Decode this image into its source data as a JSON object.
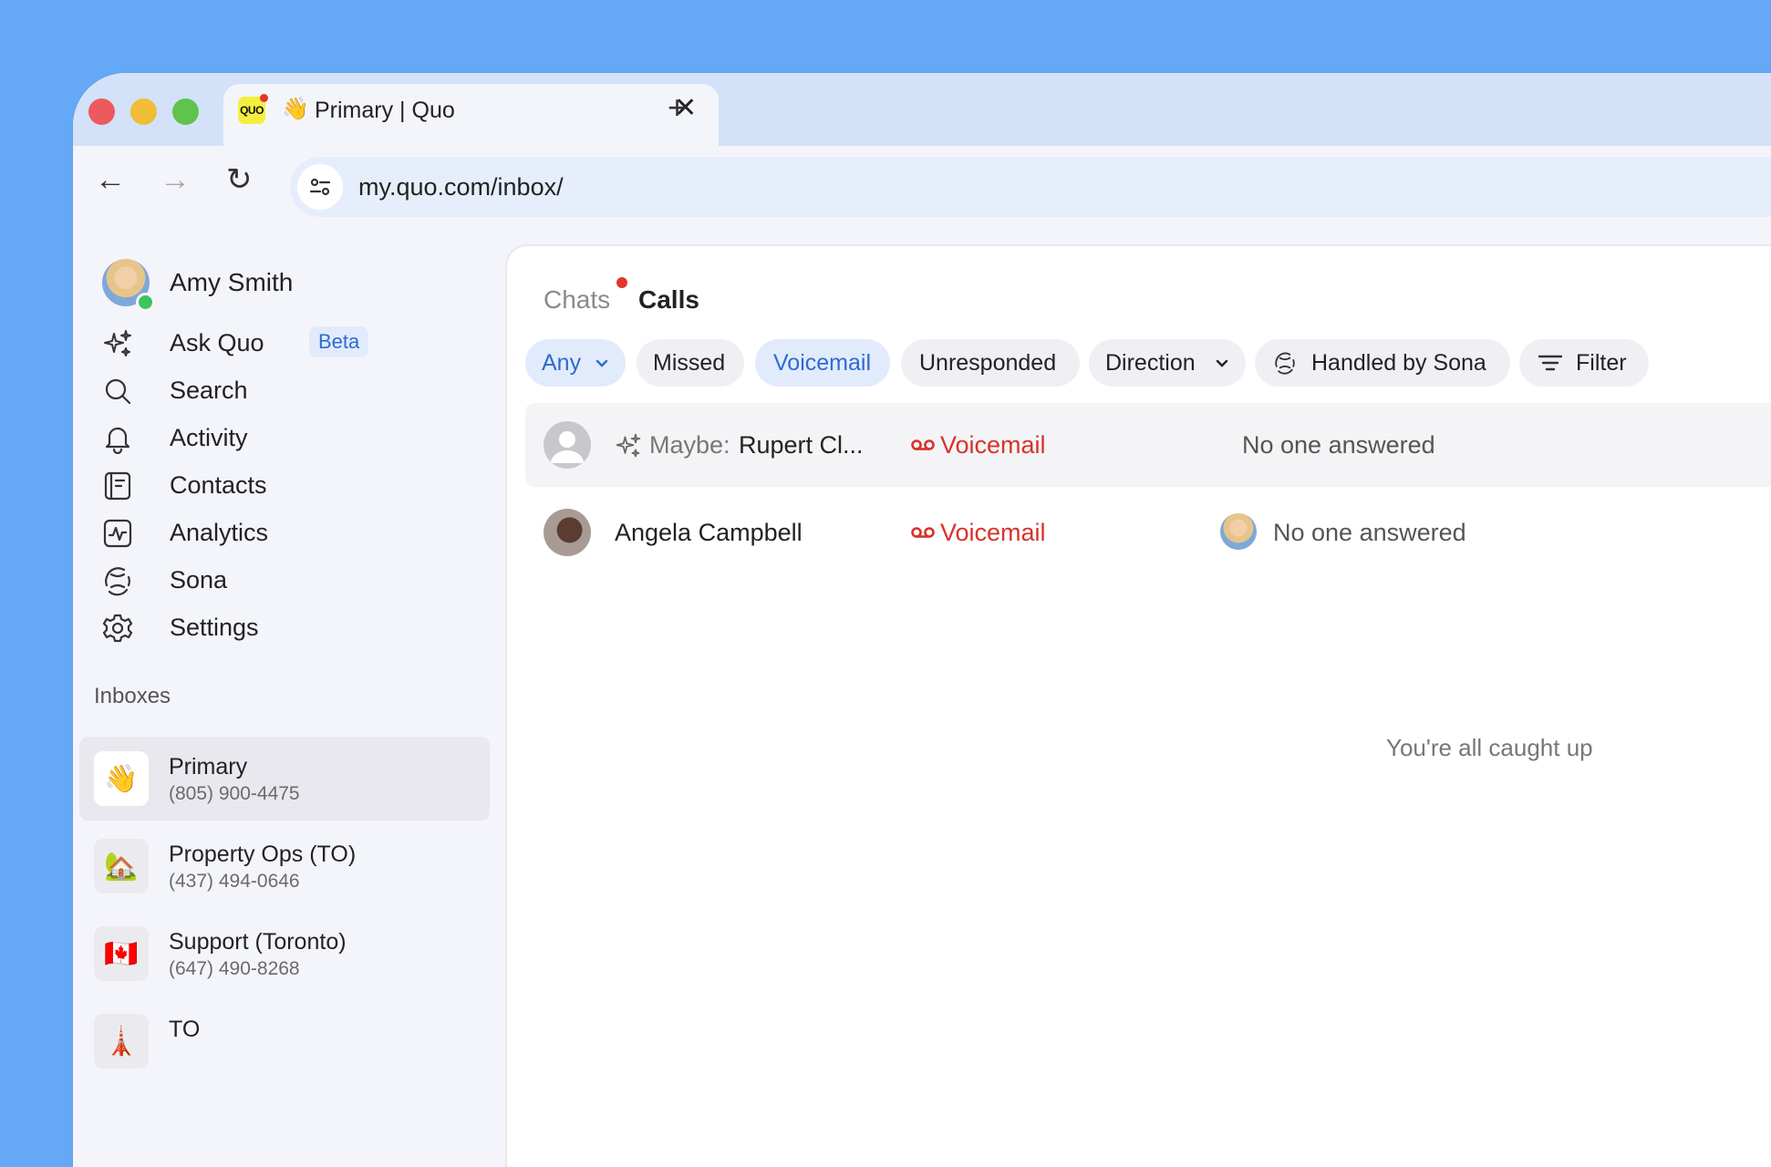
{
  "browser": {
    "favicon_text": "QUO",
    "tab_emoji": "👋",
    "tab_title": "Primary | Quo",
    "tab_close": "✕",
    "new_tab": "+",
    "back": "←",
    "forward": "→",
    "reload": "↻",
    "url": "my.quo.com/inbox/"
  },
  "user": {
    "name": "Amy Smith"
  },
  "sidebar": {
    "nav": [
      {
        "label": "Ask Quo",
        "icon": "sparkles-icon",
        "badge": "Beta"
      },
      {
        "label": "Search",
        "icon": "search-icon"
      },
      {
        "label": "Activity",
        "icon": "bell-icon"
      },
      {
        "label": "Contacts",
        "icon": "contacts-icon"
      },
      {
        "label": "Analytics",
        "icon": "analytics-icon"
      },
      {
        "label": "Sona",
        "icon": "sona-icon"
      },
      {
        "label": "Settings",
        "icon": "gear-icon"
      }
    ],
    "inboxes_header": "Inboxes",
    "inboxes": [
      {
        "emoji": "👋",
        "name": "Primary",
        "number": "(805) 900-4475",
        "active": true
      },
      {
        "emoji": "🏡",
        "name": "Property Ops (TO)",
        "number": "(437) 494-0646"
      },
      {
        "emoji": "🇨🇦",
        "name": "Support (Toronto)",
        "number": "(647) 490-8268"
      },
      {
        "emoji": "🗼",
        "name": "TO",
        "number": ""
      }
    ]
  },
  "main": {
    "tabs": {
      "chats": "Chats",
      "calls": "Calls"
    },
    "filters": {
      "any": "Any",
      "missed": "Missed",
      "voicemail": "Voicemail",
      "unresponded": "Unresponded",
      "direction": "Direction",
      "handled_by_sona": "Handled by Sona",
      "filter": "Filter"
    },
    "calls": [
      {
        "prefix": "Maybe:",
        "name": "Rupert Cl...",
        "type": "Voicemail",
        "status": "No one answered"
      },
      {
        "name": "Angela Campbell",
        "type": "Voicemail",
        "status": "No one answered"
      }
    ],
    "empty_message": "You're all caught up"
  },
  "colors": {
    "background": "#64a8f6",
    "accent": "#2e6bd1",
    "voicemail": "#d8322a",
    "online": "#3ec45a"
  }
}
